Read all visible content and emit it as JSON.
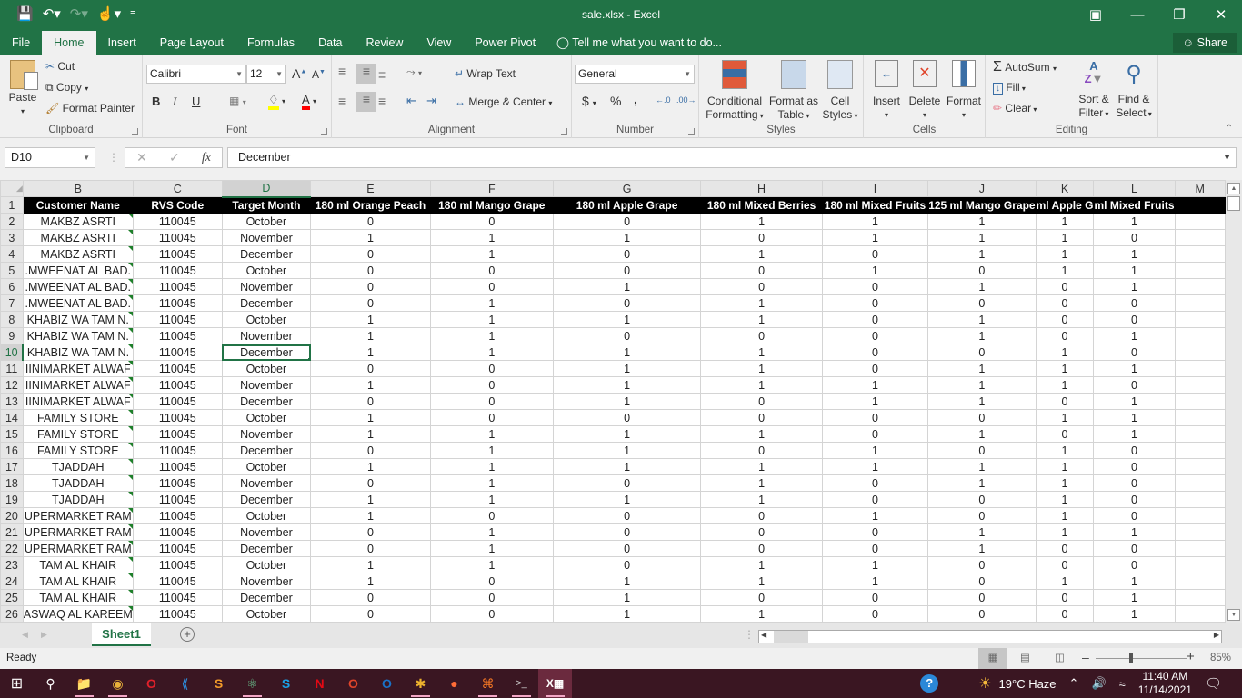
{
  "window": {
    "title": "sale.xlsx - Excel",
    "controls": [
      "ribbon-display-icon",
      "minimize-icon",
      "restore-icon",
      "close-icon"
    ]
  },
  "quick_access": [
    "save-icon",
    "undo-icon",
    "redo-icon",
    "touch-mode-icon",
    "customize-icon"
  ],
  "tabs": [
    {
      "label": "File"
    },
    {
      "label": "Home",
      "active": true
    },
    {
      "label": "Insert"
    },
    {
      "label": "Page Layout"
    },
    {
      "label": "Formulas"
    },
    {
      "label": "Data"
    },
    {
      "label": "Review"
    },
    {
      "label": "View"
    },
    {
      "label": "Power Pivot"
    }
  ],
  "tell_me": "Tell me what you want to do...",
  "share": "Share",
  "ribbon": {
    "clipboard": {
      "label": "Clipboard",
      "paste": "Paste",
      "cut": "Cut",
      "copy": "Copy",
      "format_painter": "Format Painter"
    },
    "font": {
      "label": "Font",
      "name": "Calibri",
      "size": "12",
      "bold": "B",
      "italic": "I",
      "underline": "U"
    },
    "alignment": {
      "label": "Alignment",
      "wrap": "Wrap Text",
      "merge": "Merge & Center"
    },
    "number": {
      "label": "Number",
      "format": "General",
      "currency": "$",
      "percent": "%",
      "comma": ","
    },
    "styles": {
      "label": "Styles",
      "conditional": "Conditional",
      "conditional2": "Formatting",
      "format_table": "Format as",
      "format_table2": "Table",
      "cell_styles": "Cell",
      "cell_styles2": "Styles"
    },
    "cells": {
      "label": "Cells",
      "insert": "Insert",
      "delete": "Delete",
      "format": "Format"
    },
    "editing": {
      "label": "Editing",
      "autosum": "AutoSum",
      "fill": "Fill",
      "clear": "Clear",
      "sort": "Sort &",
      "sort2": "Filter",
      "find": "Find &",
      "find2": "Select"
    }
  },
  "formula_bar": {
    "name_box": "D10",
    "fx": "fx",
    "value": "December"
  },
  "columns": [
    "B",
    "C",
    "D",
    "E",
    "F",
    "G",
    "H",
    "I",
    "J",
    "K",
    "L",
    "M"
  ],
  "selected_column": "D",
  "selected_row": 10,
  "header_row": [
    "Customer Name",
    "RVS Code",
    "Target Month",
    "180 ml Orange Peach",
    "180 ml Mango Grape",
    "180 ml Apple Grape",
    "180 ml Mixed Berries",
    "180 ml Mixed Fruits",
    "125 ml Mango Grape",
    "ml Apple G",
    "ml Mixed Fruits",
    ""
  ],
  "rows": [
    {
      "n": 2,
      "name": "MAKBZ ASRTI",
      "code": "110045",
      "month": "October",
      "v": [
        0,
        0,
        0,
        1,
        1,
        1,
        1,
        1
      ]
    },
    {
      "n": 3,
      "name": "MAKBZ ASRTI",
      "code": "110045",
      "month": "November",
      "v": [
        1,
        1,
        1,
        0,
        1,
        1,
        1,
        0
      ]
    },
    {
      "n": 4,
      "name": "MAKBZ ASRTI",
      "code": "110045",
      "month": "December",
      "v": [
        0,
        1,
        0,
        1,
        0,
        1,
        1,
        1
      ]
    },
    {
      "n": 5,
      "name": ".MWEENAT AL BAD.",
      "code": "110045",
      "month": "October",
      "v": [
        0,
        0,
        0,
        0,
        1,
        0,
        1,
        1
      ]
    },
    {
      "n": 6,
      "name": ".MWEENAT AL BAD.",
      "code": "110045",
      "month": "November",
      "v": [
        0,
        0,
        1,
        0,
        0,
        1,
        0,
        1
      ]
    },
    {
      "n": 7,
      "name": ".MWEENAT AL BAD.",
      "code": "110045",
      "month": "December",
      "v": [
        0,
        1,
        0,
        1,
        0,
        0,
        0,
        0
      ]
    },
    {
      "n": 8,
      "name": "KHABIZ WA TAM N.",
      "code": "110045",
      "month": "October",
      "v": [
        1,
        1,
        1,
        1,
        0,
        1,
        0,
        0
      ]
    },
    {
      "n": 9,
      "name": "KHABIZ WA TAM N.",
      "code": "110045",
      "month": "November",
      "v": [
        1,
        1,
        0,
        0,
        0,
        1,
        0,
        1
      ]
    },
    {
      "n": 10,
      "name": "KHABIZ WA TAM N.",
      "code": "110045",
      "month": "December",
      "v": [
        1,
        1,
        1,
        1,
        0,
        0,
        1,
        0
      ]
    },
    {
      "n": 11,
      "name": "IINIMARKET ALWAF",
      "code": "110045",
      "month": "October",
      "v": [
        0,
        0,
        1,
        1,
        0,
        1,
        1,
        1
      ]
    },
    {
      "n": 12,
      "name": "IINIMARKET ALWAF",
      "code": "110045",
      "month": "November",
      "v": [
        1,
        0,
        1,
        1,
        1,
        1,
        1,
        0
      ]
    },
    {
      "n": 13,
      "name": "IINIMARKET ALWAF",
      "code": "110045",
      "month": "December",
      "v": [
        0,
        0,
        1,
        0,
        1,
        1,
        0,
        1
      ]
    },
    {
      "n": 14,
      "name": "FAMILY STORE",
      "code": "110045",
      "month": "October",
      "v": [
        1,
        0,
        0,
        0,
        0,
        0,
        1,
        1
      ]
    },
    {
      "n": 15,
      "name": "FAMILY STORE",
      "code": "110045",
      "month": "November",
      "v": [
        1,
        1,
        1,
        1,
        0,
        1,
        0,
        1
      ]
    },
    {
      "n": 16,
      "name": "FAMILY STORE",
      "code": "110045",
      "month": "December",
      "v": [
        0,
        1,
        1,
        0,
        1,
        0,
        1,
        0
      ]
    },
    {
      "n": 17,
      "name": "TJADDAH",
      "code": "110045",
      "month": "October",
      "v": [
        1,
        1,
        1,
        1,
        1,
        1,
        1,
        0
      ]
    },
    {
      "n": 18,
      "name": "TJADDAH",
      "code": "110045",
      "month": "November",
      "v": [
        0,
        1,
        0,
        1,
        0,
        1,
        1,
        0
      ]
    },
    {
      "n": 19,
      "name": "TJADDAH",
      "code": "110045",
      "month": "December",
      "v": [
        1,
        1,
        1,
        1,
        0,
        0,
        1,
        0
      ]
    },
    {
      "n": 20,
      "name": "UPERMARKET RAM",
      "code": "110045",
      "month": "October",
      "v": [
        1,
        0,
        0,
        0,
        1,
        0,
        1,
        0
      ]
    },
    {
      "n": 21,
      "name": "UPERMARKET RAM",
      "code": "110045",
      "month": "November",
      "v": [
        0,
        1,
        0,
        0,
        0,
        1,
        1,
        1
      ]
    },
    {
      "n": 22,
      "name": "UPERMARKET RAM",
      "code": "110045",
      "month": "December",
      "v": [
        0,
        1,
        0,
        0,
        0,
        1,
        0,
        0
      ]
    },
    {
      "n": 23,
      "name": "TAM AL KHAIR",
      "code": "110045",
      "month": "October",
      "v": [
        1,
        1,
        0,
        1,
        1,
        0,
        0,
        0
      ]
    },
    {
      "n": 24,
      "name": "TAM AL KHAIR",
      "code": "110045",
      "month": "November",
      "v": [
        1,
        0,
        1,
        1,
        1,
        0,
        1,
        1
      ]
    },
    {
      "n": 25,
      "name": "TAM AL KHAIR",
      "code": "110045",
      "month": "December",
      "v": [
        0,
        0,
        1,
        0,
        0,
        0,
        0,
        1
      ]
    },
    {
      "n": 26,
      "name": "ASWAQ AL KAREEM",
      "code": "110045",
      "month": "October",
      "v": [
        0,
        0,
        1,
        1,
        0,
        0,
        0,
        1
      ]
    }
  ],
  "sheets": [
    {
      "label": "Sheet1",
      "active": true
    }
  ],
  "status": {
    "text": "Ready",
    "zoom": "85%",
    "zoom_percent": 85
  },
  "taskbar": {
    "apps": [
      "windows-start-icon",
      "search-icon",
      "file-explorer-icon",
      "chrome-icon",
      "opera-icon",
      "vscode-icon",
      "sublime-icon",
      "atom-icon",
      "skype-icon",
      "netflix-icon",
      "office-icon",
      "outlook-icon",
      "slack-icon",
      "postman-icon",
      "xampp-icon",
      "terminal-icon",
      "excel-icon"
    ],
    "weather": "19°C  Haze",
    "time": "11:40 AM",
    "date": "11/14/2021"
  },
  "colors": {
    "accent": "#217346",
    "taskbar": "#3a1622"
  }
}
